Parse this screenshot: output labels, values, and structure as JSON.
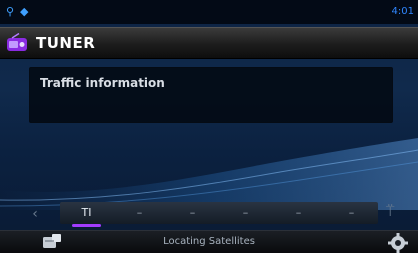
{
  "status_bar": {
    "time": "4:01"
  },
  "header": {
    "title": "TUNER"
  },
  "info_panel": {
    "text": "Traffic information"
  },
  "presets": {
    "items": [
      "TI",
      "–",
      "–",
      "–",
      "–",
      "–"
    ],
    "active_index": 0
  },
  "footer": {
    "status_message": "Locating Satellites"
  },
  "colors": {
    "accent": "#a23cff",
    "status_icon": "#3fa0ff",
    "background": "#102a4c"
  }
}
